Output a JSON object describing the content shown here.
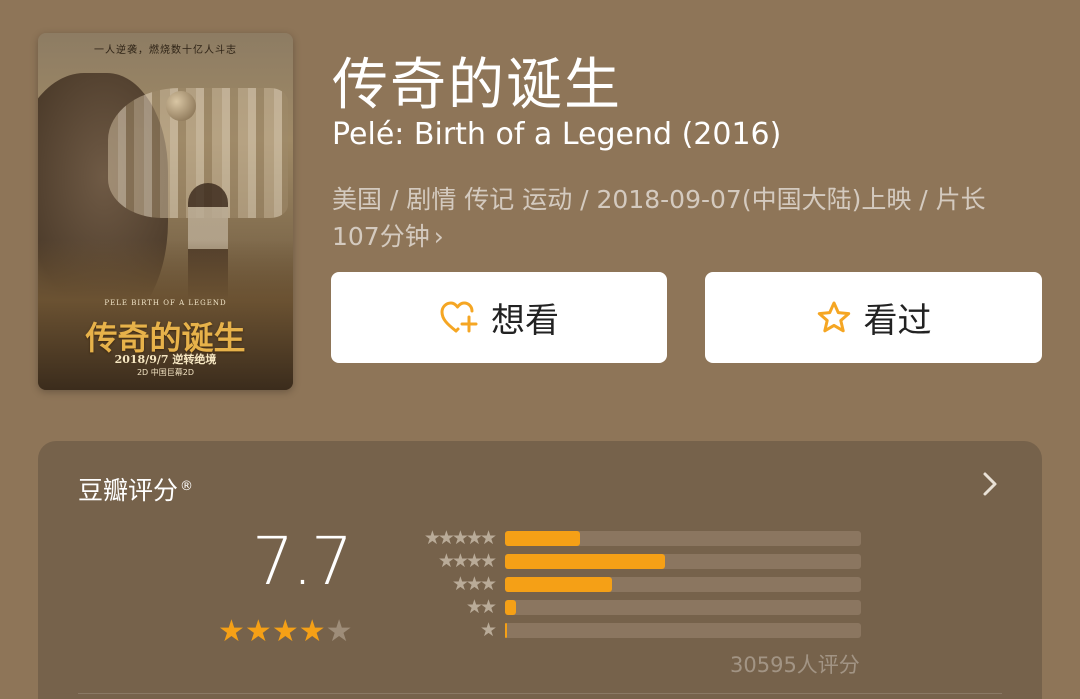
{
  "poster": {
    "tagline": "一人逆袭，燃烧数十亿人斗志",
    "english_title": "PELE BIRTH OF A LEGEND",
    "chinese_title": "传奇的诞生",
    "date_line": "2018/9/7 逆转绝境",
    "format_line": "2D 中国巨幕2D"
  },
  "movie": {
    "title_zh": "传奇的诞生",
    "title_en": "Pelé: Birth of a Legend (2016)",
    "meta": "美国 / 剧情 传记 运动 / 2018-09-07(中国大陆)上映 / 片长107分钟",
    "meta_chevron": "›"
  },
  "actions": {
    "want_label": "想看",
    "want_icon": "heart-plus-icon",
    "seen_label": "看过",
    "seen_icon": "star-outline-icon",
    "accent_color": "#f5a623"
  },
  "rating": {
    "title": "豆瓣评分",
    "registered_mark": "®",
    "score": "7.7",
    "stars_filled": 4,
    "stars_total": 5,
    "distribution": [
      {
        "stars": "★★★★★",
        "fraction": 0.21
      },
      {
        "stars": "★★★★",
        "fraction": 0.45
      },
      {
        "stars": "★★★",
        "fraction": 0.3
      },
      {
        "stars": "★★",
        "fraction": 0.03
      },
      {
        "stars": "★",
        "fraction": 0.005
      }
    ],
    "vote_count": "30595人评分",
    "star_color": "#f5a016",
    "empty_star_color": "#9e8d79"
  }
}
